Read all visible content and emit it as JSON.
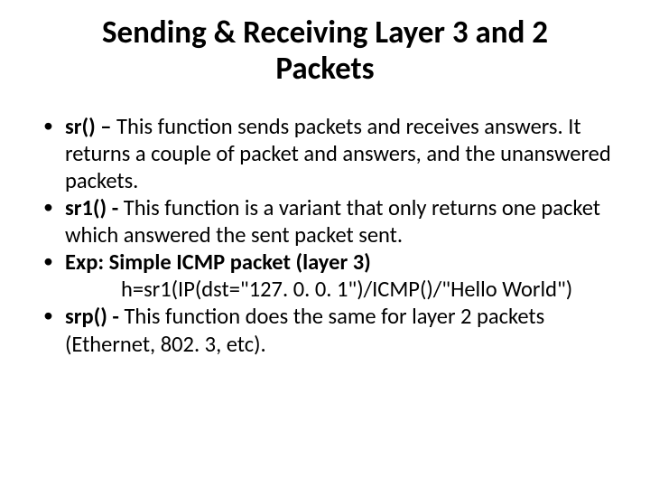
{
  "title": "Sending & Receiving Layer 3 and 2 Packets",
  "items": [
    {
      "bold": "sr() – ",
      "text": "This function sends packets and receives answers. It returns a couple of packet and answers, and the unanswered packets."
    },
    {
      "bold": "sr1() - ",
      "text": "This function is a variant that only returns one packet which answered the sent packet sent."
    },
    {
      "bold": "Exp:  Simple ICMP packet (layer 3)",
      "text": ""
    },
    {
      "code": "h=sr1(IP(dst=\"127. 0. 0. 1\")/ICMP()/\"Hello World\")"
    },
    {
      "bold": "srp() - ",
      "text": "This function does the same for layer 2 packets (Ethernet, 802. 3, etc)."
    }
  ]
}
